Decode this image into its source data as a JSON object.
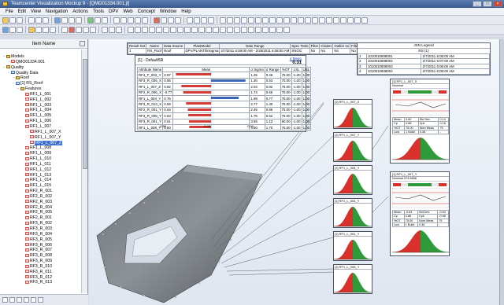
{
  "window": {
    "title": "Teamcenter Visualization Mockup 9 - [QMO01334.001,jt]"
  },
  "menu": [
    "File",
    "Edit",
    "View",
    "Navigation",
    "Actions",
    "Tools",
    "DPV",
    "Web",
    "Concept",
    "Window",
    "Help"
  ],
  "tree": {
    "header": "Item Name",
    "nodes": [
      {
        "label": "Models",
        "level": 0,
        "icon": "folder"
      },
      {
        "label": "QMO01334.001",
        "level": 1,
        "icon": "part"
      },
      {
        "label": "Quality",
        "level": 0,
        "icon": "folder"
      },
      {
        "label": "Quality Data",
        "level": 1,
        "icon": "qual"
      },
      {
        "label": "Roof",
        "level": 2,
        "icon": "folder"
      },
      {
        "label": "[1] RS_Roof",
        "level": 2,
        "icon": "qual"
      },
      {
        "label": "Features",
        "level": 3,
        "icon": "folder"
      },
      {
        "label": "RF1_L_001",
        "level": 4,
        "icon": "part"
      },
      {
        "label": "RF1_L_002",
        "level": 4,
        "icon": "part"
      },
      {
        "label": "RF1_L_003",
        "level": 4,
        "icon": "part"
      },
      {
        "label": "RF1_L_004",
        "level": 4,
        "icon": "part"
      },
      {
        "label": "RF1_L_005",
        "level": 4,
        "icon": "part"
      },
      {
        "label": "RF1_L_006",
        "level": 4,
        "icon": "part"
      },
      {
        "label": "RF1_L_007",
        "level": 4,
        "icon": "part"
      },
      {
        "label": "RF1_L_007_X",
        "level": 5,
        "icon": "part"
      },
      {
        "label": "RF1_L_007_Y",
        "level": 5,
        "icon": "part"
      },
      {
        "label": "RF1_L_007_Z",
        "level": 5,
        "icon": "part",
        "selected": true
      },
      {
        "label": "RF1_L_008",
        "level": 4,
        "icon": "part"
      },
      {
        "label": "RF1_L_009",
        "level": 4,
        "icon": "part"
      },
      {
        "label": "RF1_L_010",
        "level": 4,
        "icon": "part"
      },
      {
        "label": "RF1_L_011",
        "level": 4,
        "icon": "part"
      },
      {
        "label": "RF1_L_012",
        "level": 4,
        "icon": "part"
      },
      {
        "label": "RF1_L_013",
        "level": 4,
        "icon": "part"
      },
      {
        "label": "RF1_L_014",
        "level": 4,
        "icon": "part"
      },
      {
        "label": "RF1_L_015",
        "level": 4,
        "icon": "part"
      },
      {
        "label": "RF2_R_001",
        "level": 4,
        "icon": "part"
      },
      {
        "label": "RF2_R_002",
        "level": 4,
        "icon": "part"
      },
      {
        "label": "RF2_R_003",
        "level": 4,
        "icon": "part"
      },
      {
        "label": "RF2_R_004",
        "level": 4,
        "icon": "part"
      },
      {
        "label": "RF2_R_005",
        "level": 4,
        "icon": "part"
      },
      {
        "label": "RF2_R_001",
        "level": 4,
        "icon": "part"
      },
      {
        "label": "RF3_R_002",
        "level": 4,
        "icon": "part"
      },
      {
        "label": "RF3_R_003",
        "level": 4,
        "icon": "part"
      },
      {
        "label": "RF3_R_004",
        "level": 4,
        "icon": "part"
      },
      {
        "label": "RF3_R_005",
        "level": 4,
        "icon": "part"
      },
      {
        "label": "RF3_R_006",
        "level": 4,
        "icon": "part"
      },
      {
        "label": "RF3_R_007",
        "level": 4,
        "icon": "part"
      },
      {
        "label": "RF3_R_008",
        "level": 4,
        "icon": "part"
      },
      {
        "label": "RF3_R_009",
        "level": 4,
        "icon": "part"
      },
      {
        "label": "RF3_R_010",
        "level": 4,
        "icon": "part"
      },
      {
        "label": "RF3_R_011",
        "level": 4,
        "icon": "part"
      },
      {
        "label": "RF3_R_012",
        "level": 4,
        "icon": "part"
      },
      {
        "label": "RF3_R_013",
        "level": 4,
        "icon": "part"
      }
    ]
  },
  "stat_summary": {
    "headers": [
      "Result Set",
      "Name",
      "Data Source",
      "PlantModel",
      "Date Range",
      "Spec Tests",
      "Filter",
      "Cluster",
      "Outlier ex",
      "Filter Trend"
    ],
    "row": [
      "1",
      "RS_Roof",
      "Roof",
      "DPV/PLANT/linlogma",
      "2/7/2011 6:08:00 AM - 2/28/2011 6:08:00 AM",
      "SNGG",
      "No",
      "No",
      "No",
      "No"
    ]
  },
  "attr_panel": {
    "title": "[1] - Default5R",
    "sigma_label": "σ Mean",
    "sigma_value": "0.31",
    "headers": [
      "Attribute Name",
      "Mean",
      "σ Sigma",
      "σ Range",
      "%OT",
      "LSL",
      "USL"
    ],
    "rows": [
      [
        "RF4_F_003_Y",
        "0.97",
        "1.25",
        "0.46",
        "75.00",
        "-1.00",
        "1.00"
      ],
      [
        "RF3_R_005_X",
        "0.95",
        "1.30",
        "0.53",
        "75.00",
        "-1.00",
        "1.00"
      ],
      [
        "RF1_L_007_Z",
        "0.82",
        "2.04",
        "0.82",
        "75.00",
        "-1.00",
        "1.00"
      ],
      [
        "RF2_R_006_X",
        "-0.77",
        "1.74",
        "0.65",
        "75.00",
        "-1.00",
        "1.00"
      ],
      [
        "RF1_L_004_Y",
        "0.76",
        "1.99",
        "0.77",
        "75.00",
        "-1.00",
        "1.00"
      ],
      [
        "RF3_R_013_X",
        "0.69",
        "2.77",
        "1.40",
        "75.00",
        "-1.00",
        "1.00"
      ],
      [
        "RF2_R_001_Y",
        "0.64",
        "2.45",
        "0.86",
        "75.00",
        "-1.00",
        "1.00"
      ],
      [
        "RF3_R_005_Y",
        "0.63",
        "1.76",
        "0.62",
        "75.00",
        "-1.00",
        "1.00"
      ],
      [
        "RF3_R_001_Y",
        "0.61",
        "3.55",
        "1.13",
        "60.00",
        "-1.00",
        "1.00"
      ],
      [
        "RF1_L_008_Y",
        "0.60",
        "4.60",
        "1.70",
        "75.00",
        "-1.00",
        "1.00"
      ]
    ],
    "bar_values": [
      -0.97,
      0.95,
      -0.82,
      -0.77,
      0.76,
      -0.69,
      -0.64,
      -0.63,
      -0.61,
      -0.6
    ],
    "axis_ticks": [
      "-0.96",
      "-0.03",
      "0.90"
    ]
  },
  "jsn_legend": {
    "title": "JSN Legend",
    "subtitle": "RS (1)",
    "rows": [
      [
        "1",
        "1010010808001",
        "2/7/2011 6:08:00 AM"
      ],
      [
        "2",
        "1010010808002",
        "2/7/2011 6:07:00 AM"
      ],
      [
        "3",
        "1010010808003",
        "2/7/2011 6:06:00 AM"
      ],
      [
        "4",
        "1010010808004",
        "2/7/2011 6:05:00 AM"
      ]
    ]
  },
  "mini_charts": [
    {
      "caption": "[1] RF1_L_007_Z"
    },
    {
      "caption": "[1] RF1_L_007_Y"
    },
    {
      "caption": "[1] RF1_L_004_Y"
    },
    {
      "caption": "[1] RF1_L_004_Y"
    },
    {
      "caption": "[1] RF1_L_001_Y"
    },
    {
      "caption": "[1] RF1_L_008_Y"
    },
    {
      "caption": "[1] RF1_L_007_Y"
    }
  ],
  "big_charts": [
    {
      "caption": "[1] RF1_L_007_X",
      "row1": "Nominal",
      "stats": [
        [
          "Mean",
          "0.82",
          "Std Dev",
          "0.14"
        ],
        [
          "Cp",
          "0.88",
          "Cpk",
          "0.16"
        ],
        [
          "%OT",
          "75.00",
          "Nom Meas",
          "75"
        ],
        [
          "Low",
          "1 Build",
          "0.36",
          "-"
        ]
      ]
    },
    {
      "caption": "[1] RF1_L_007_Y",
      "row1": "Nominal 574.5668",
      "stats": [
        [
          "Mean",
          "-0.63",
          "Std Dev",
          "-0.64"
        ],
        [
          "Cp",
          "0.88",
          "Cpk",
          "-0.66"
        ],
        [
          "%OT",
          "75.00",
          "Nom Meas",
          "75"
        ],
        [
          "Low",
          "1 Build",
          "0.36",
          "-"
        ]
      ]
    }
  ],
  "colors": {
    "accent": "#3d6fd1",
    "bar_negative": "#d43b34",
    "bar_positive": "#3a64b8",
    "curve_red": "#d9312b",
    "curve_green": "#2f9a3a"
  }
}
